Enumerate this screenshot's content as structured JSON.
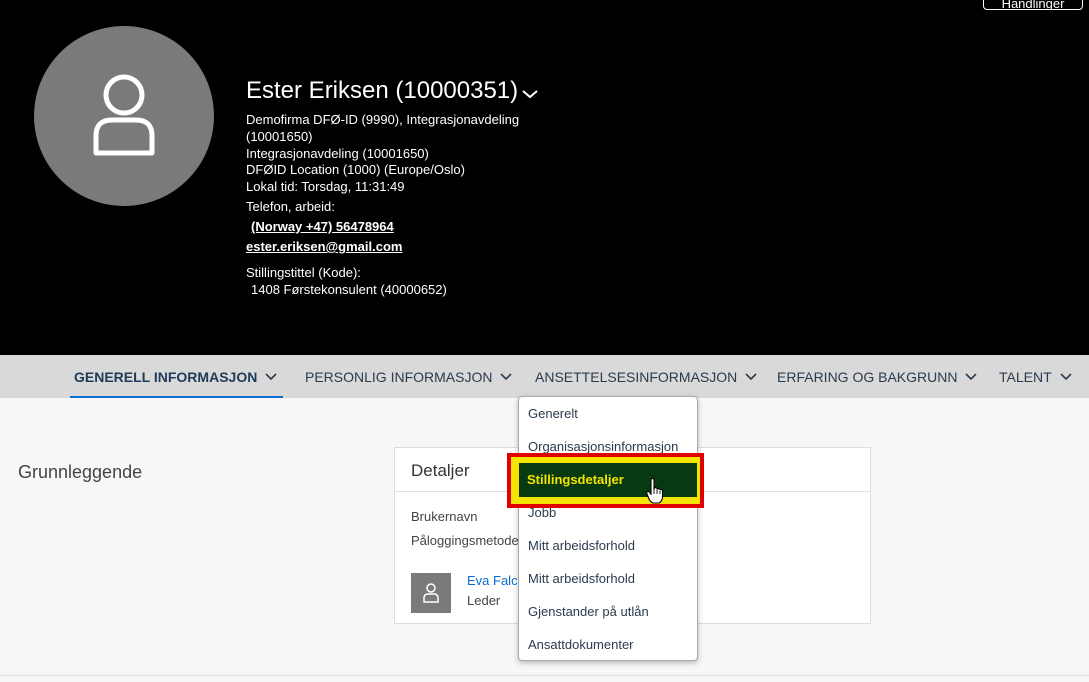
{
  "header": {
    "actions_label": "Handlinger",
    "name": "Ester Eriksen (10000351)",
    "company_line1": "Demofirma DFØ-ID (9990), Integrasjonavdeling",
    "company_line2": "(10001650)",
    "department": "Integrasjonavdeling (10001650)",
    "location": "DFØID Location (1000) (Europe/Oslo)",
    "local_time": "Lokal tid: Torsdag, 11:31:49",
    "phone_label": "Telefon, arbeid:",
    "phone": "(Norway +47) 56478964",
    "email": "ester.eriksen@gmail.com",
    "job_title_label": "Stillingstittel (Kode):",
    "job_title": "1408 Førstekonsulent (40000652)"
  },
  "tabs": [
    {
      "label": "GENERELL INFORMASJON",
      "active": true
    },
    {
      "label": "PERSONLIG INFORMASJON",
      "active": false
    },
    {
      "label": "ANSETTELSESINFORMASJON",
      "active": false
    },
    {
      "label": "ERFARING OG BAKGRUNN",
      "active": false
    },
    {
      "label": "TALENT",
      "active": false
    }
  ],
  "section": {
    "title": "Grunnleggende"
  },
  "card": {
    "title": "Detaljer",
    "username_label": "Brukernavn",
    "login_method_label": "Påloggingsmetode",
    "manager_name": "Eva Falck",
    "manager_role": "Leder"
  },
  "dropdown": {
    "items": [
      "Generelt",
      "Organisasjonsinformasjon",
      "Stillingsdetaljer",
      "Jobb",
      "Mitt arbeidsforhold",
      "Mitt arbeidsforhold",
      "Gjenstander på utlån",
      "Ansattdokumenter"
    ],
    "highlighted_index": 2
  },
  "colors": {
    "header_bg": "#000000",
    "tab_bar_bg": "#d9d9d9",
    "accent": "#0a6ed1",
    "highlight_bg": "#073a10",
    "highlight_text": "#f5e400",
    "highlight_border": "#e00000"
  },
  "icons": [
    "person-icon",
    "chevron-down-icon",
    "hand-cursor-icon"
  ]
}
